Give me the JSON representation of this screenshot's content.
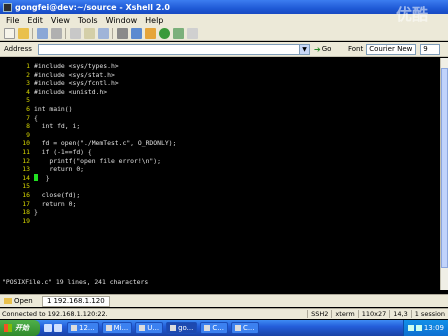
{
  "window": {
    "title": "gongfei@dev:~/source - Xshell 2.0"
  },
  "menu": [
    "File",
    "Edit",
    "View",
    "Tools",
    "Window",
    "Help"
  ],
  "address": {
    "label": "Address",
    "value": "",
    "go_label": "Go"
  },
  "font": {
    "label": "Font",
    "family": "Courier New",
    "size": "9"
  },
  "terminal": {
    "lines": [
      {
        "n": "1",
        "text": "#include <sys/types.h>"
      },
      {
        "n": "2",
        "text": "#include <sys/stat.h>"
      },
      {
        "n": "3",
        "text": "#include <sys/fcntl.h>"
      },
      {
        "n": "4",
        "text": "#include <unistd.h>"
      },
      {
        "n": "5",
        "text": ""
      },
      {
        "n": "6",
        "text": "int main()"
      },
      {
        "n": "7",
        "text": "{"
      },
      {
        "n": "8",
        "text": "  int fd, i;"
      },
      {
        "n": "9",
        "text": ""
      },
      {
        "n": "10",
        "text": "  fd = open(\"./MemTest.c\", O_RDONLY);"
      },
      {
        "n": "11",
        "text": "  if (-1==fd) {"
      },
      {
        "n": "12",
        "text": "    printf(\"open file error!\\n\");"
      },
      {
        "n": "13",
        "text": "    return 0;"
      },
      {
        "n": "14",
        "text": "  }"
      },
      {
        "n": "15",
        "text": ""
      },
      {
        "n": "16",
        "text": "  close(fd);"
      },
      {
        "n": "17",
        "text": "  return 0;"
      },
      {
        "n": "18",
        "text": "}"
      },
      {
        "n": "19",
        "text": ""
      }
    ],
    "status_message": "\"POSIXFile.c\" 19 lines, 241 characters"
  },
  "tabs": {
    "open_label": "Open",
    "session_number": "1",
    "session_label": "192.168.1.120"
  },
  "statusbar": {
    "connection": "Connected to 192.168.1.120:22.",
    "protocol": "SSH2",
    "term": "xterm",
    "size": "110x27",
    "position": "14,3",
    "sessions": "1 session"
  },
  "taskbar": {
    "start_label": "开始",
    "tasks": [
      "…",
      "…",
      "12...",
      "Mi...",
      "U...",
      "go...",
      "C...",
      "C..."
    ],
    "clock": "13:09"
  },
  "watermark": "优酷"
}
